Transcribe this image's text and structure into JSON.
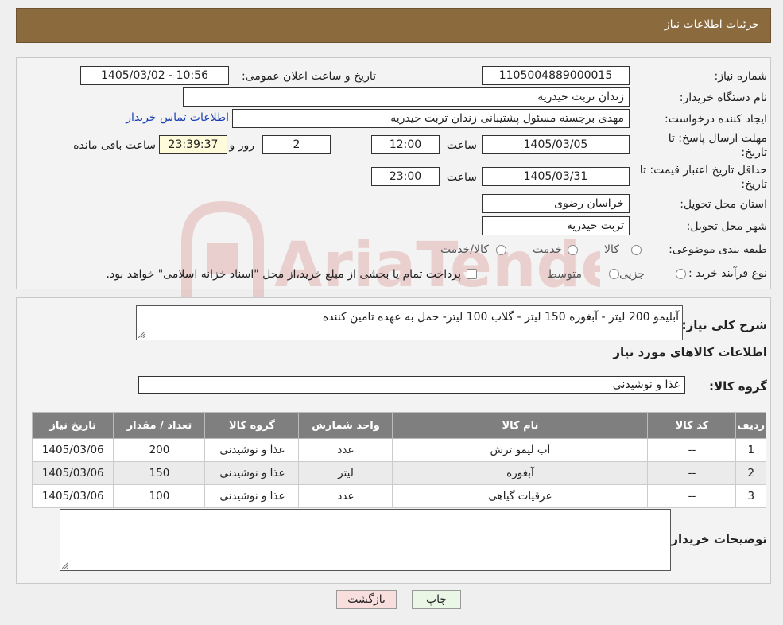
{
  "header": {
    "title": "جزئیات اطلاعات نیاز"
  },
  "watermark": {
    "text": "AriaTender.neT",
    "color": "#c0392b"
  },
  "details": {
    "need_number_label": "شماره نیاز:",
    "need_number": "1105004889000015",
    "announce_label": "تاریخ و ساعت اعلان عمومی:",
    "announce_value": "1405/03/02 - 10:56",
    "buyer_org_label": "نام دستگاه خریدار:",
    "buyer_org": "زندان تربت حیدریه",
    "requester_label": "ایجاد کننده درخواست:",
    "requester": "مهدی برجسته مسئول پشتیبانی زندان تربت حیدریه",
    "contact_link": "اطلاعات تماس خریدار",
    "deadline_label": "مهلت ارسال پاسخ: تا تاریخ:",
    "deadline_date": "1405/03/05",
    "time_label": "ساعت",
    "deadline_time": "12:00",
    "days": "2",
    "days_label": "روز و",
    "remaining": "23:39:37",
    "remaining_label": "ساعت باقی مانده",
    "validity_label": "حداقل تاریخ اعتبار قیمت: تا تاریخ:",
    "validity_date": "1405/03/31",
    "validity_time": "23:00",
    "province_label": "استان محل تحویل:",
    "province": "خراسان رضوی",
    "city_label": "شهر محل تحویل:",
    "city": "تربت حیدریه",
    "category_label": "طبقه بندی موضوعی:",
    "category_options": [
      "کالا",
      "خدمت",
      "کالا/خدمت"
    ],
    "process_label": "نوع فرآیند خرید :",
    "process_options": [
      "جزیی",
      "متوسط"
    ],
    "process_note": "پرداخت تمام یا بخشی از مبلغ خرید،از محل \"اسناد خزانه اسلامی\" خواهد بود."
  },
  "summary": {
    "desc_label": "شرح کلی نیاز:",
    "desc_value": "آبلیمو 200 لیتر - آبغوره 150 لیتر - گلاب 100 لیتر- حمل به عهده تامین کننده",
    "goods_title": "اطلاعات کالاهای مورد نیاز",
    "group_label": "گروه کالا:",
    "group_value": "غذا و نوشیدنی"
  },
  "table": {
    "headers": [
      "ردیف",
      "کد کالا",
      "نام کالا",
      "واحد شمارش",
      "گروه کالا",
      "تعداد / مقدار",
      "تاریخ نیاز"
    ],
    "rows": [
      [
        "1",
        "--",
        "آب لیمو ترش",
        "عدد",
        "غذا و نوشیدنی",
        "200",
        "1405/03/06"
      ],
      [
        "2",
        "--",
        "آبغوره",
        "لیتر",
        "غذا و نوشیدنی",
        "150",
        "1405/03/06"
      ],
      [
        "3",
        "--",
        "عرقیات گیاهی",
        "عدد",
        "غذا و نوشیدنی",
        "100",
        "1405/03/06"
      ]
    ]
  },
  "notes": {
    "label": "توضیحات خریدار:"
  },
  "buttons": {
    "print": "چاپ",
    "back": "بازگشت"
  }
}
